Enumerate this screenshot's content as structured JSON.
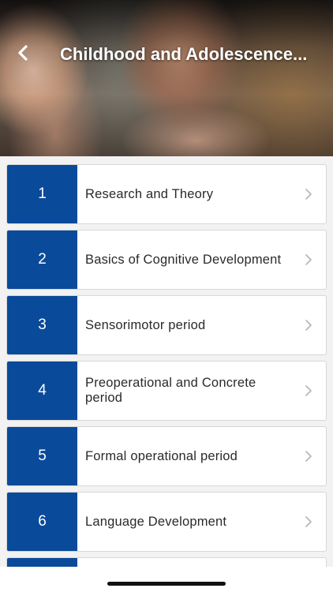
{
  "header": {
    "title": "Childhood and Adolescence...",
    "back_icon": "chevron-left-icon"
  },
  "lessons": [
    {
      "number": "1",
      "label": "Research and Theory"
    },
    {
      "number": "2",
      "label": "Basics of Cognitive Development"
    },
    {
      "number": "3",
      "label": "Sensorimotor period"
    },
    {
      "number": "4",
      "label": "Preoperational and Concrete period"
    },
    {
      "number": "5",
      "label": "Formal operational period"
    },
    {
      "number": "6",
      "label": "Language Development"
    }
  ],
  "colors": {
    "accent": "#0a4a9a",
    "chevron": "#b5b5b5",
    "background": "#f2f2f2"
  }
}
